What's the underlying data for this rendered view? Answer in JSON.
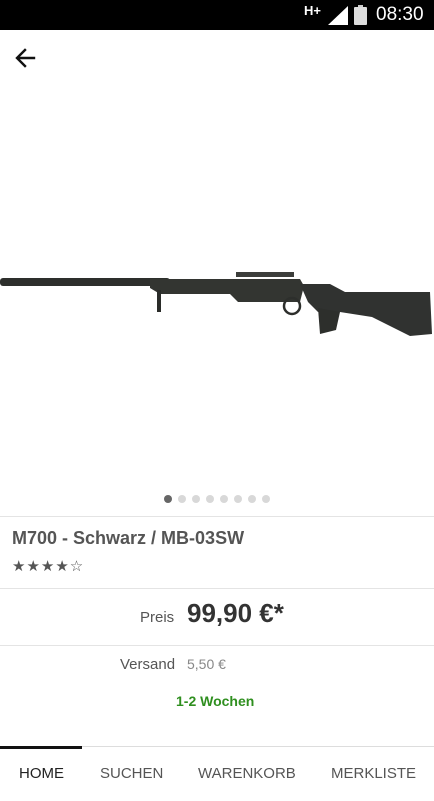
{
  "status_bar": {
    "network": "H+",
    "time": "08:30"
  },
  "product": {
    "title": "M700 - Schwarz / MB-03SW",
    "rating_stars": "★★★★☆",
    "rating": 4,
    "price_label": "Preis",
    "price": "99,90 €*",
    "shipping_label": "Versand",
    "shipping_value": "5,50 €",
    "delivery_time": "1-2 Wochen"
  },
  "gallery": {
    "image_count": 8,
    "current_index": 0
  },
  "tabs": [
    {
      "label": "HOME",
      "active": true
    },
    {
      "label": "SUCHEN",
      "active": false
    },
    {
      "label": "WARENKORB",
      "active": false
    },
    {
      "label": "MERKLISTE",
      "active": false
    }
  ],
  "colors": {
    "accent": "#2f8f1f",
    "status_bar": "#000000"
  }
}
